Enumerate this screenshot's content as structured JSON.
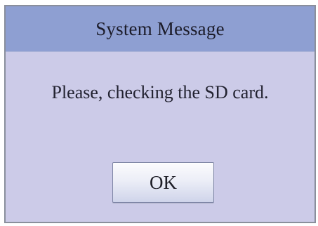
{
  "dialog": {
    "title": "System Message",
    "message": "Please, checking the SD card.",
    "ok_label": "OK"
  },
  "colors": {
    "title_bar": "#8e9fd2",
    "body_background": "#cccbe8",
    "border": "#8a8f9c"
  }
}
